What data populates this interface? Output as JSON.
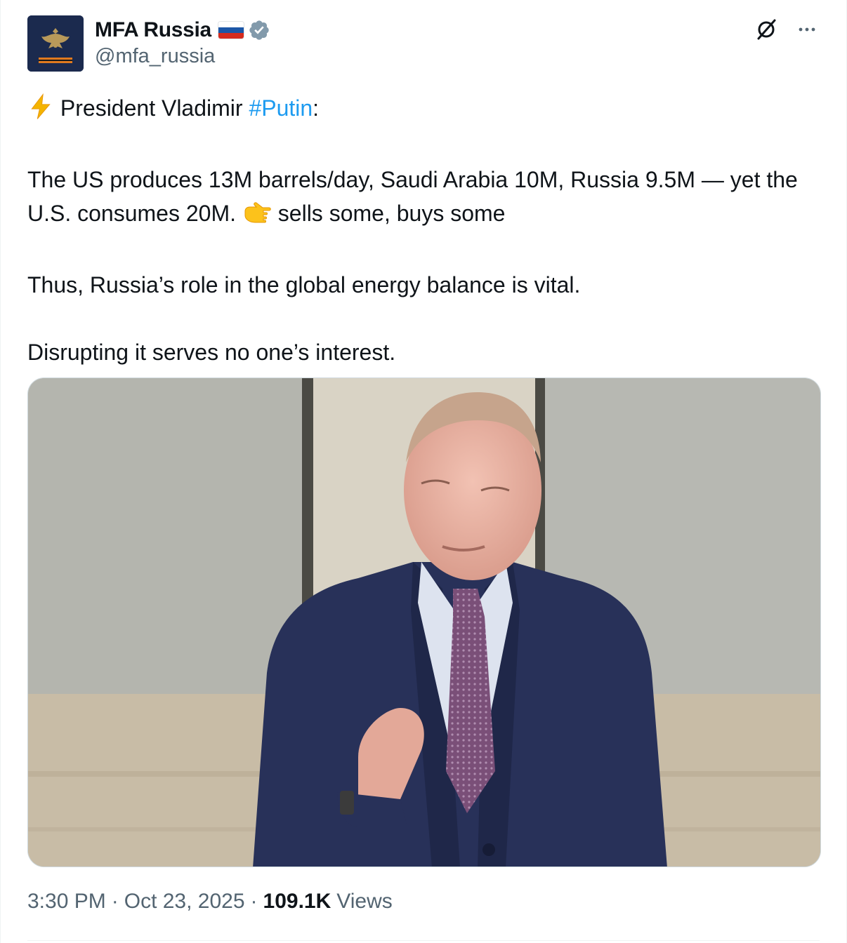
{
  "author": {
    "name": "MFA Russia",
    "handle": "@mfa_russia",
    "flag_colors": [
      "#ffffff",
      "#1c57a7",
      "#d52b1e"
    ],
    "verified_color": "#829aab"
  },
  "icons": {
    "avatar": "russian-coat-of-arms-icon",
    "verified": "verified-badge-icon",
    "grok": "grok-icon",
    "more": "more-options-icon",
    "lightning": "high-voltage-emoji",
    "pointing": "backhand-index-pointing-right-emoji"
  },
  "tweet": {
    "line1_prefix": "President Vladimir ",
    "hashtag": "#Putin",
    "line1_suffix": ":",
    "para2_part1": "The US produces 13M barrels/day, Saudi Arabia 10M, Russia 9.5M — yet the U.S. consumes 20M. ",
    "para2_part2": " sells some, buys some",
    "para3": "Thus, Russia’s role in the global energy balance is vital.",
    "para4": "Disrupting it serves no one’s interest."
  },
  "meta": {
    "time": "3:30 PM",
    "sep1": "·",
    "date": "Oct 23, 2025",
    "sep2": "·",
    "views_count": "109.1K",
    "views_label": "Views"
  },
  "colors": {
    "link": "#1d9bf0",
    "secondary_text": "#536471",
    "suit": "#27305a",
    "tie": "#6e4a6e"
  }
}
